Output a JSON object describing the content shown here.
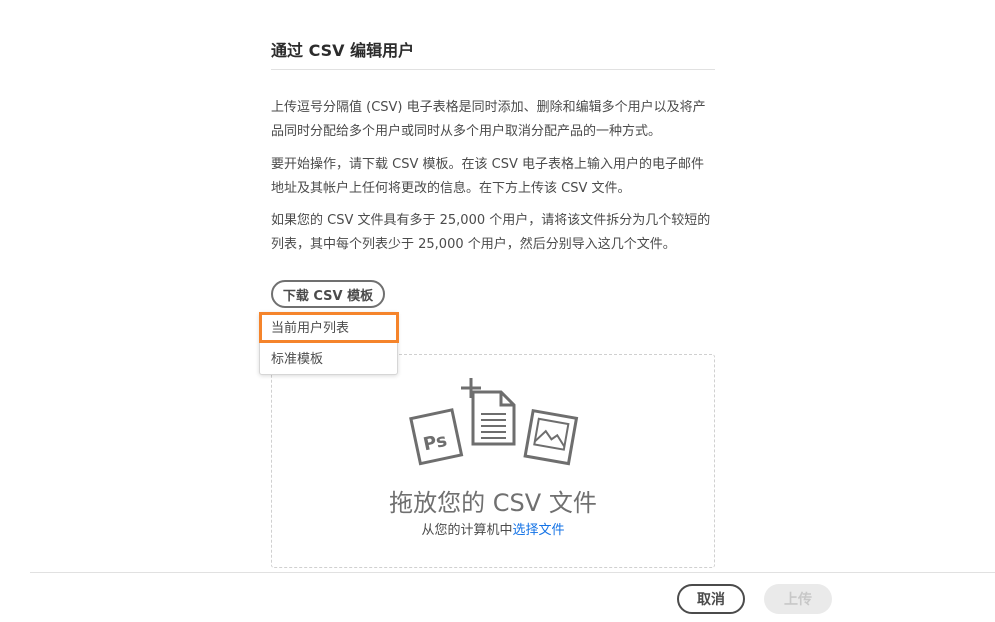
{
  "dialog": {
    "title": "通过 CSV 编辑用户",
    "paragraphs": [
      "上传逗号分隔值 (CSV) 电子表格是同时添加、删除和编辑多个用户以及将产品同时分配给多个用户或同时从多个用户取消分配产品的一种方式。",
      "要开始操作，请下载 CSV 模板。在该 CSV 电子表格上输入用户的电子邮件地址及其帐户上任何将更改的信息。在下方上传该 CSV 文件。",
      "如果您的 CSV 文件具有多于 25,000 个用户，请将该文件拆分为几个较短的列表，其中每个列表少于 25,000 个用户，然后分别导入这几个文件。"
    ]
  },
  "download": {
    "button_label": "下载 CSV 模板",
    "menu_items": [
      "当前用户列表",
      "标准模板"
    ]
  },
  "dropzone": {
    "title": "拖放您的 CSV 文件",
    "subtitle_prefix": "从您的计算机中",
    "subtitle_link": "选择文件",
    "icons": [
      "photoshop-file-icon",
      "add-document-icon",
      "image-file-icon"
    ]
  },
  "footer": {
    "cancel_label": "取消",
    "upload_label": "上传"
  },
  "colors": {
    "highlight": "#f5842b",
    "link": "#1473e6",
    "disabled_bg": "#eaeaea"
  }
}
